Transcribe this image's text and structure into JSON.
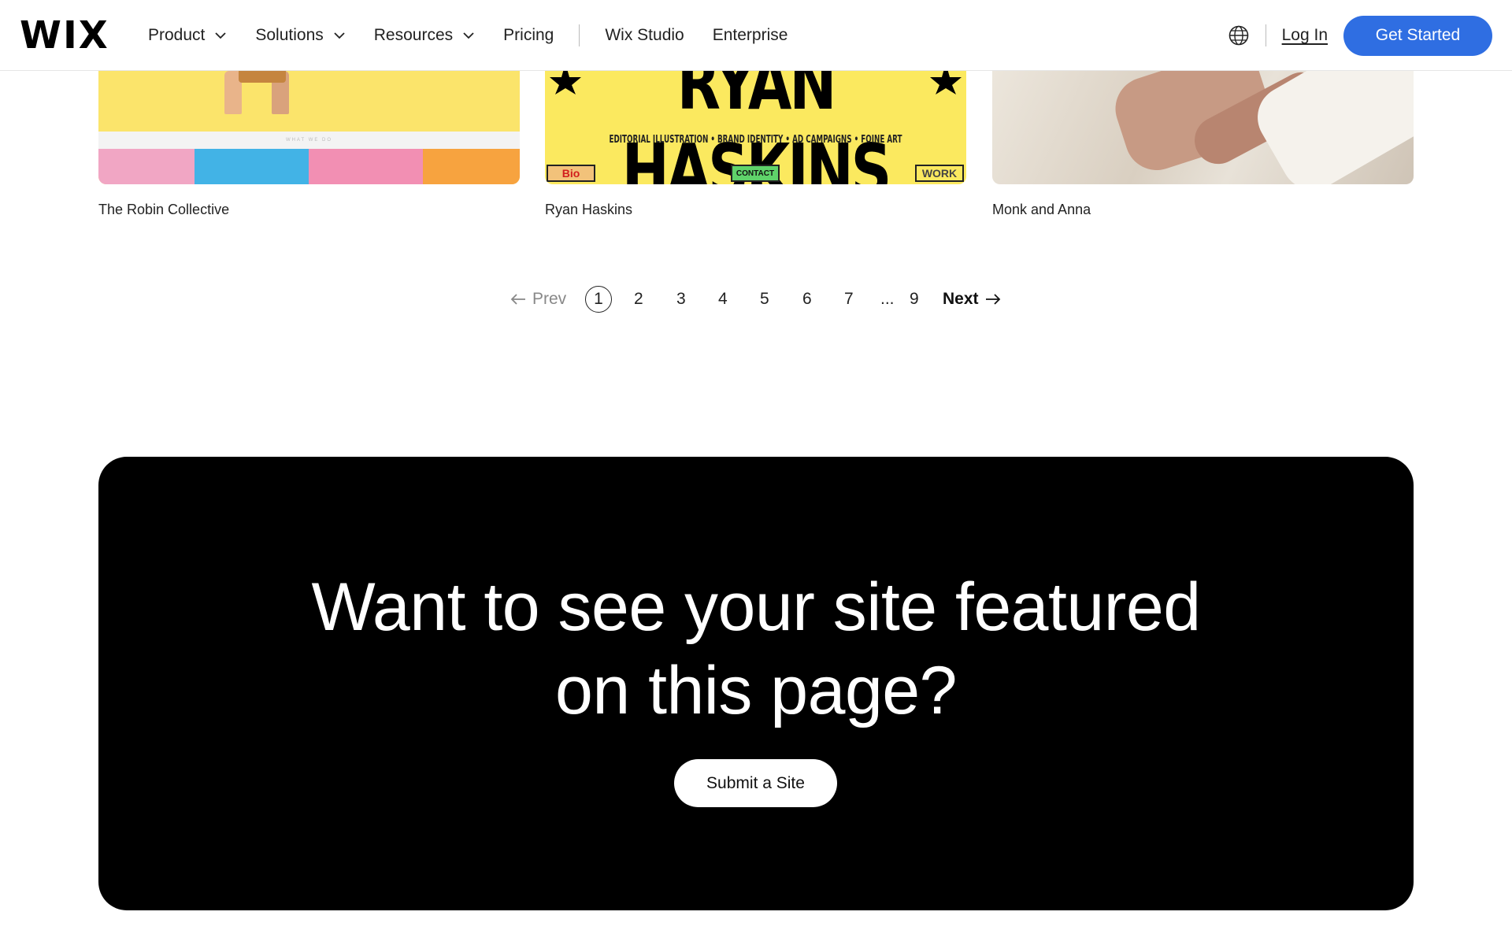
{
  "header": {
    "logo": "WIX",
    "nav": [
      {
        "label": "Product",
        "has_dropdown": true
      },
      {
        "label": "Solutions",
        "has_dropdown": true
      },
      {
        "label": "Resources",
        "has_dropdown": true
      },
      {
        "label": "Pricing",
        "has_dropdown": false
      },
      {
        "label": "Wix Studio",
        "has_dropdown": false
      },
      {
        "label": "Enterprise",
        "has_dropdown": false
      }
    ],
    "language_icon": "globe-icon",
    "login_label": "Log In",
    "cta_label": "Get Started",
    "cta_color": "#2f6ee2"
  },
  "gallery": {
    "cards": [
      {
        "name": "The Robin Collective",
        "preview_strip_text": "WHAT WE DO"
      },
      {
        "name": "Ryan Haskins",
        "preview_title": "RYAN HASKINS",
        "preview_subtitle": "EDITORIAL ILLUSTRATION • BRAND IDENTITY • AD CAMPAIGNS • FOINE ART",
        "preview_tags": [
          "Bio",
          "CONTACT",
          "WORK"
        ]
      },
      {
        "name": "Monk and Anna"
      }
    ]
  },
  "pagination": {
    "prev_label": "Prev",
    "pages": [
      "1",
      "2",
      "3",
      "4",
      "5",
      "6",
      "7"
    ],
    "ellipsis": "...",
    "last_page": "9",
    "current": "1",
    "next_label": "Next"
  },
  "banner": {
    "heading_line1": "Want to see your site featured",
    "heading_line2": "on this page?",
    "button_label": "Submit a Site"
  }
}
